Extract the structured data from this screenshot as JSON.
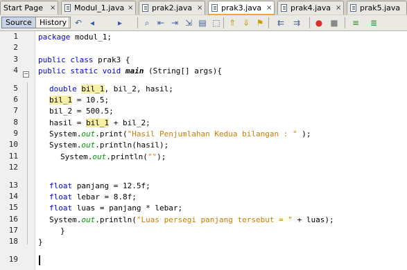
{
  "tabs": [
    {
      "label": "Start Page",
      "icon": "none"
    },
    {
      "label": "Modul_1.java",
      "icon": "java-file-icon"
    },
    {
      "label": "prak2.java",
      "icon": "java-file-icon"
    },
    {
      "label": "prak3.java",
      "icon": "java-file-icon",
      "active": true
    },
    {
      "label": "prak4.java",
      "icon": "java-file-icon"
    },
    {
      "label": "prak5.java",
      "icon": "java-file-icon"
    }
  ],
  "tab_close_glyph": "×",
  "toolbar": {
    "source": "Source",
    "history": "History"
  },
  "line_numbers": [
    "1",
    "2",
    "3",
    "4",
    "5",
    "6",
    "7",
    "8",
    "9",
    "10",
    "11",
    "12",
    "13",
    "14",
    "15",
    "16",
    "17",
    "18",
    "19"
  ],
  "code": {
    "l1": {
      "kw": "package",
      "rest": " modul_1;"
    },
    "l3": {
      "kw1": "public",
      "kw2": "class",
      "rest": " prak3 {"
    },
    "l4": {
      "kw1": "public",
      "kw2": "static",
      "kw3": "void",
      "name": "main",
      "rest": " (String[] args){"
    },
    "l5": {
      "kw": "double",
      "hl": "bil_1",
      "rest": ", bil_2, hasil;"
    },
    "l6": {
      "hl": "bil_1",
      "rest": " = 10.5;"
    },
    "l7": {
      "text": "bil_2 = 500.5;"
    },
    "l8": {
      "pre": "hasil = ",
      "hl": "bil_1",
      "rest": " + bil_2;"
    },
    "l9": {
      "pre": "System.",
      "out": "out",
      "mid": ".print(",
      "str": "\"Hasil Penjumlahan Kedua bilangan : \"",
      "rest": " );"
    },
    "l10": {
      "pre": "System.",
      "out": "out",
      "mid": ".println(hasil);"
    },
    "l11": {
      "pre": "System.",
      "out": "out",
      "mid": ".println(",
      "str": "\"\"",
      "rest": ");"
    },
    "l13": {
      "kw": "float",
      "rest": " panjang = 12.5f;"
    },
    "l14": {
      "kw": "float",
      "rest": " lebar = 8.8f;"
    },
    "l15": {
      "kw": "float",
      "rest": " luas = panjang * lebar;"
    },
    "l16": {
      "pre": "System.",
      "out": "out",
      "mid": ".println(",
      "str": "\"Luas persegi panjang tersebut = \"",
      "rest": " + luas);"
    },
    "l17": {
      "text": "}"
    },
    "l18": {
      "text": "}"
    }
  },
  "colors": {
    "keyword": "#0000e6",
    "string": "#ce7b00",
    "field": "#009900",
    "highlight": "#f7f0a4",
    "active_tab_accent": "#f3a63b"
  }
}
